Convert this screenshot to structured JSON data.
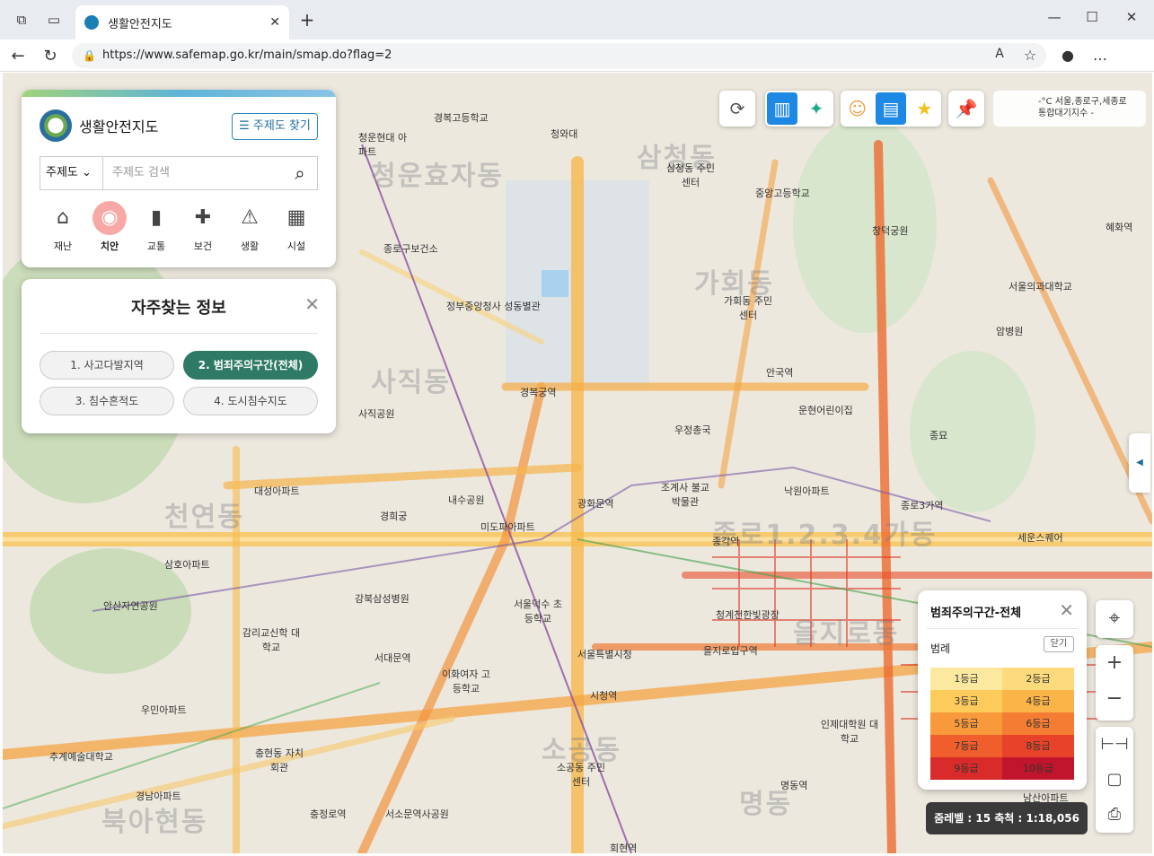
{
  "browser": {
    "tab_title": "생활안전지도",
    "url": "https://www.safemap.go.kr/main/smap.do?flag=2"
  },
  "search_panel": {
    "logo_text": "생활안전지도",
    "theme_button": "☰ 주제도 찾기",
    "select_value": "주제도",
    "search_placeholder": "주제도 검색",
    "categories": [
      {
        "label": "재난",
        "icon": "house-disaster-icon"
      },
      {
        "label": "치안",
        "icon": "police-siren-icon"
      },
      {
        "label": "교통",
        "icon": "road-icon"
      },
      {
        "label": "보건",
        "icon": "medical-kit-icon"
      },
      {
        "label": "생활",
        "icon": "person-warning-icon"
      },
      {
        "label": "시설",
        "icon": "building-icon"
      }
    ]
  },
  "freq_panel": {
    "title": "자주찾는 정보",
    "chips": [
      "1. 사고다발지역",
      "2. 범죄주의구간(전체)",
      "3. 침수흔적도",
      "4. 도시침수지도"
    ],
    "selected_chip": "2. 범죄주의구간(전체)"
  },
  "weather": {
    "temp": "-°C",
    "location": "서울,종로구,세종로",
    "aqi": "통합대기지수 -"
  },
  "legend": {
    "title": "범죄주의구간-전체",
    "label": "범례",
    "close_button": "닫기",
    "grades": [
      {
        "label": "1등급",
        "color": "#fde8a0"
      },
      {
        "label": "2등급",
        "color": "#fddb7c"
      },
      {
        "label": "3등급",
        "color": "#fccb5c"
      },
      {
        "label": "4등급",
        "color": "#fbb447"
      },
      {
        "label": "5등급",
        "color": "#f89a3c"
      },
      {
        "label": "6등급",
        "color": "#f57d33"
      },
      {
        "label": "7등급",
        "color": "#ef5e2c"
      },
      {
        "label": "8등급",
        "color": "#e8432a"
      },
      {
        "label": "9등급",
        "color": "#d92b2a"
      },
      {
        "label": "10등급",
        "color": "#c0152c"
      }
    ]
  },
  "scale": {
    "text": "줌레벨 : 15   축척 : 1:18,056"
  },
  "map_labels": [
    {
      "text": "경복고등학교"
    },
    {
      "text": "청와대"
    },
    {
      "text": "청운현대 아파트"
    },
    {
      "text": "삼청동 주민센터"
    },
    {
      "text": "중앙고등학교"
    },
    {
      "text": "창덕궁원"
    },
    {
      "text": "혜화역"
    },
    {
      "text": "종로구보건소"
    },
    {
      "text": "정부중앙청사 성동별관"
    },
    {
      "text": "가회동 주민센터"
    },
    {
      "text": "서울의과대학교"
    },
    {
      "text": "암병원"
    },
    {
      "text": "경복궁역"
    },
    {
      "text": "안국역"
    },
    {
      "text": "운현어린이집"
    },
    {
      "text": "사직공원"
    },
    {
      "text": "우정총국"
    },
    {
      "text": "종묘"
    },
    {
      "text": "대성아파트"
    },
    {
      "text": "내수공원"
    },
    {
      "text": "종로3가역"
    },
    {
      "text": "경희궁"
    },
    {
      "text": "광화문역"
    },
    {
      "text": "조계사 불교박물관"
    },
    {
      "text": "낙원아파트"
    },
    {
      "text": "미도파아파트"
    },
    {
      "text": "종각역"
    },
    {
      "text": "세운스퀘어"
    },
    {
      "text": "삼호아파트"
    },
    {
      "text": "강북삼성병원"
    },
    {
      "text": "서울덕수 초등학교"
    },
    {
      "text": "청계천한빛광장"
    },
    {
      "text": "안산자연공원"
    },
    {
      "text": "감리교신학 대학교"
    },
    {
      "text": "서대문역"
    },
    {
      "text": "서울특별시청"
    },
    {
      "text": "을지로입구역"
    },
    {
      "text": "이화여자 고등학교"
    },
    {
      "text": "우민아파트"
    },
    {
      "text": "시청역"
    },
    {
      "text": "추계예술대학교"
    },
    {
      "text": "충현동 자치회관"
    },
    {
      "text": "소공동 주민센터"
    },
    {
      "text": "인제대학원 대학교"
    },
    {
      "text": "경남아파트"
    },
    {
      "text": "충정로역"
    },
    {
      "text": "서소문역사공원"
    },
    {
      "text": "회현역"
    },
    {
      "text": "남산아파트"
    },
    {
      "text": "명동역"
    }
  ],
  "district_labels": [
    "청운효자동",
    "삼청동",
    "가회동",
    "사직동",
    "천연동",
    "종로1.2.3.4가동",
    "북아현동",
    "소공동",
    "명동",
    "을지로동"
  ]
}
